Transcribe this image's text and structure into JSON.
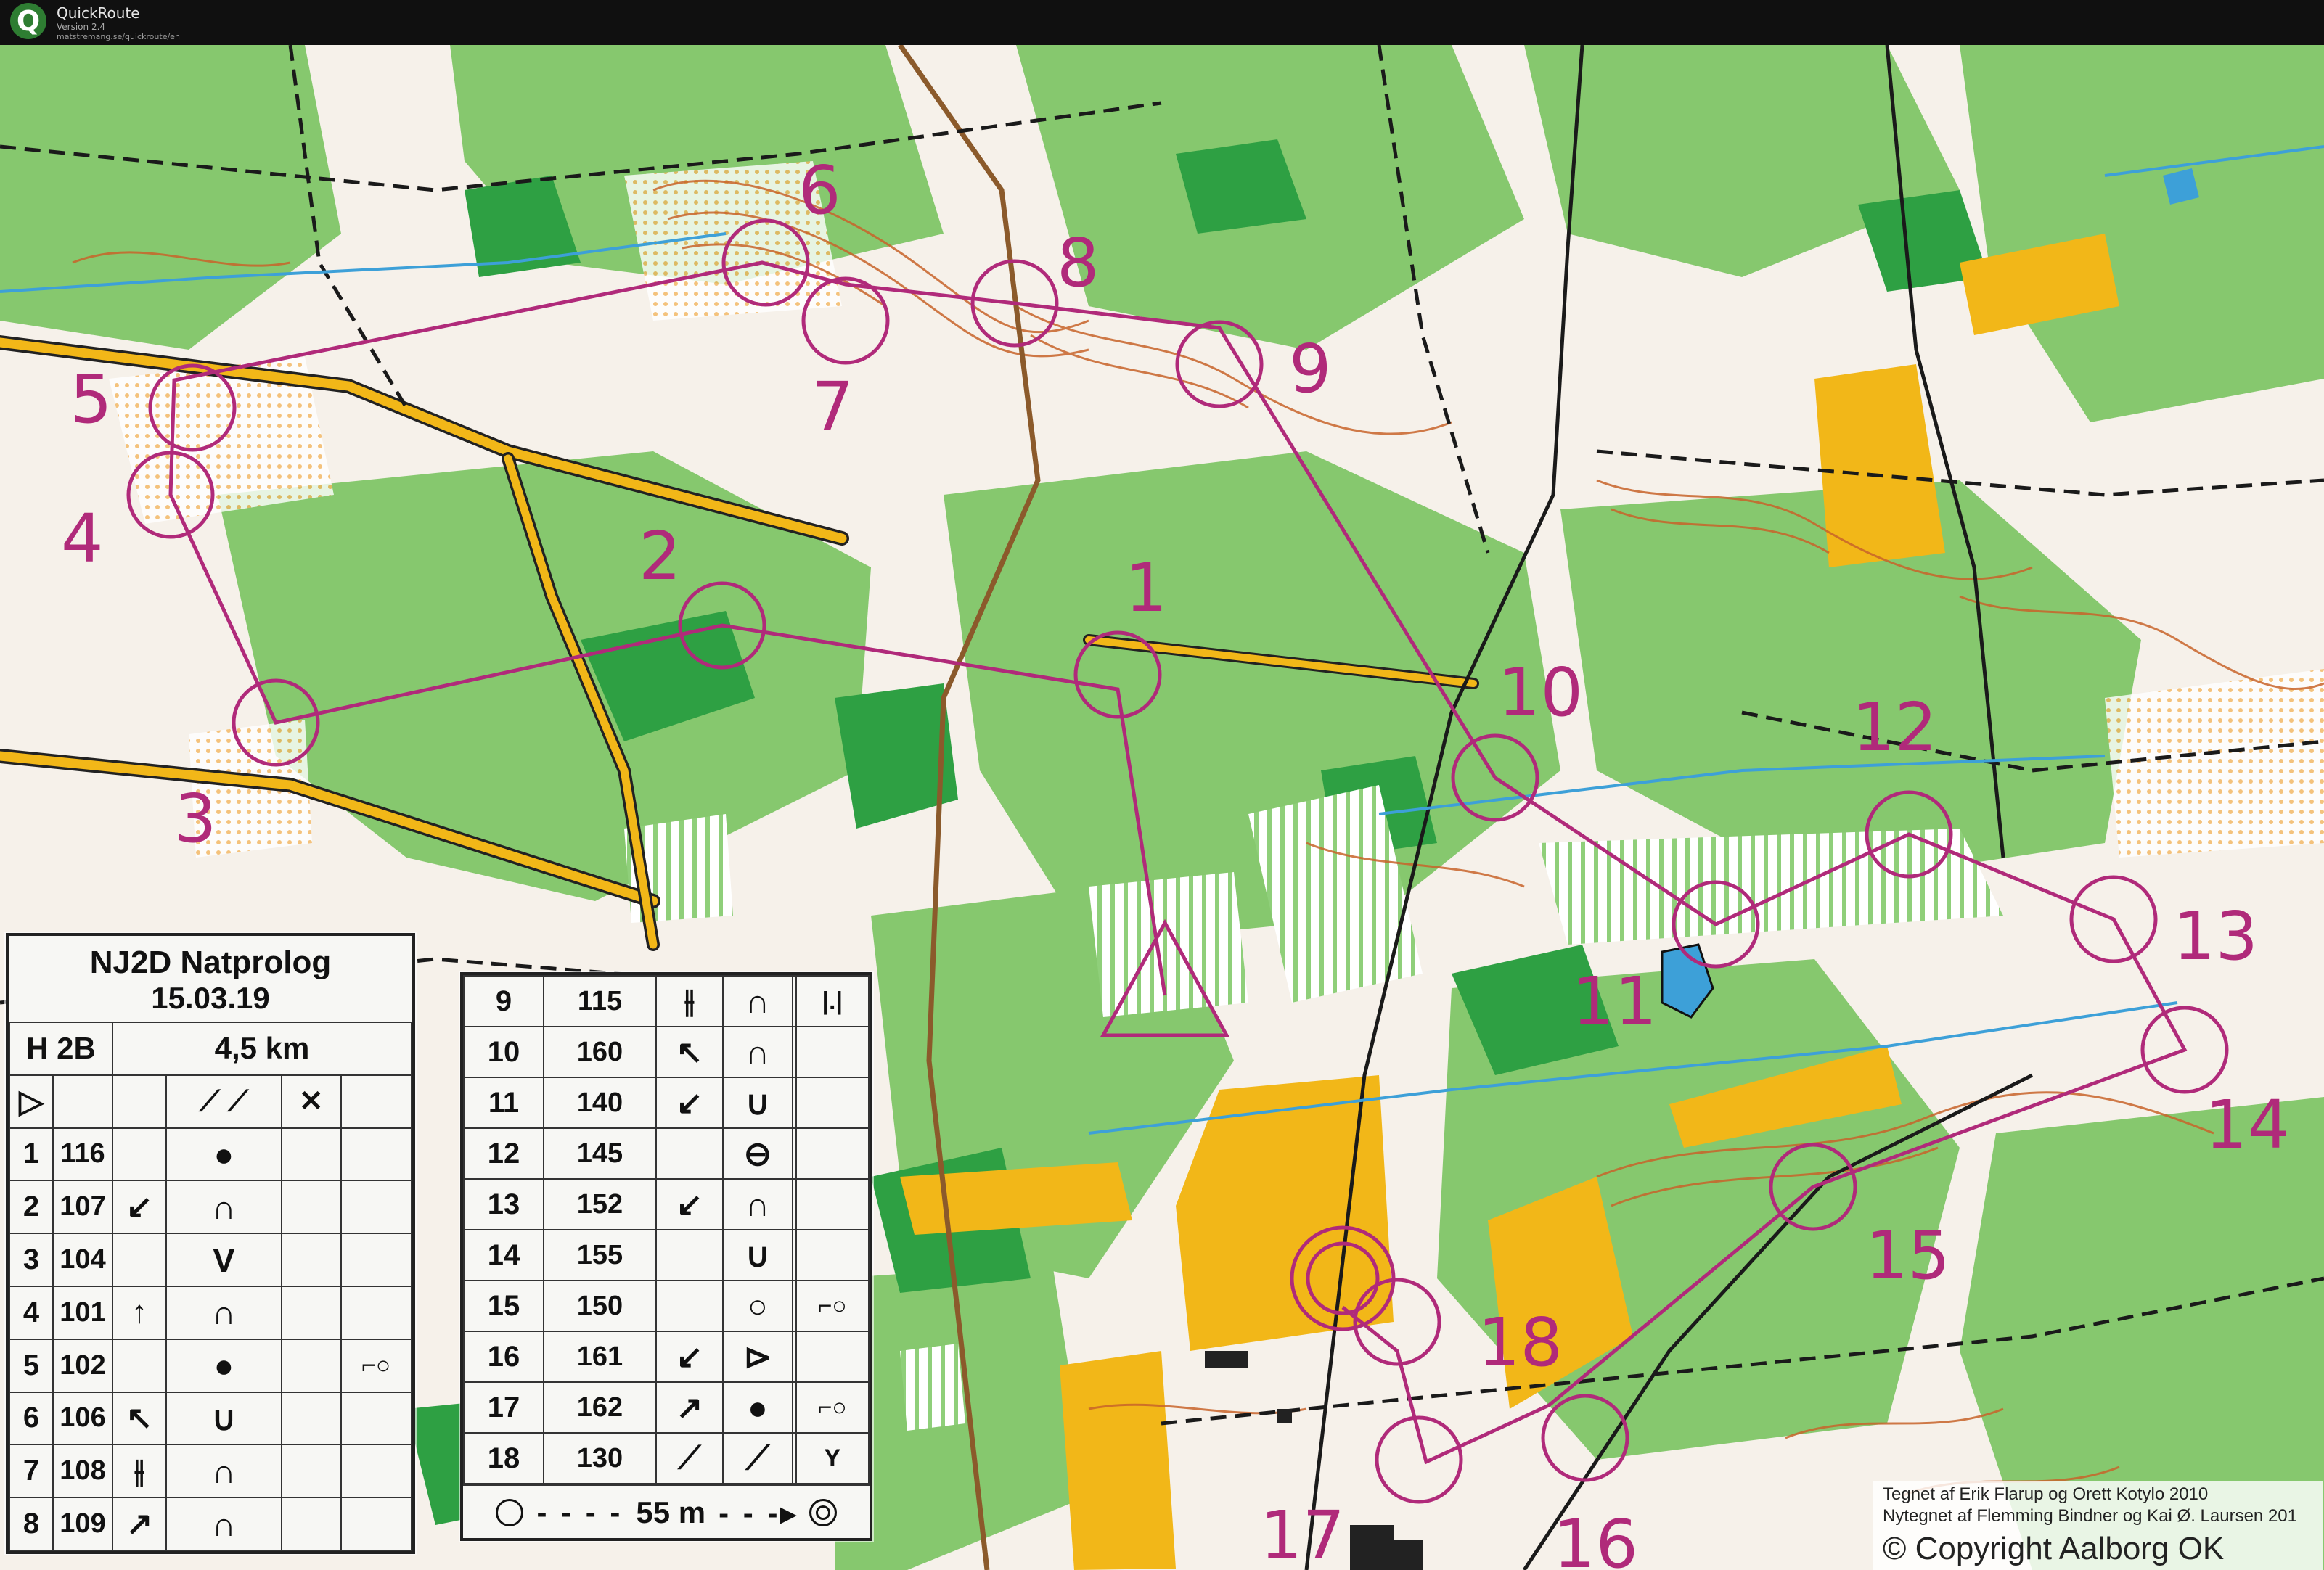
{
  "window": {
    "app_name": "QuickRoute",
    "version": "Version 2.4",
    "url": "matstremang.se/quickroute/en",
    "logo_letter": "Q"
  },
  "colors": {
    "course": "#b02a7a",
    "forest": "#7cc268",
    "dense_forest": "#2ea043",
    "open_yellow": "#f2b718",
    "contour": "#c8642a",
    "road": "#f2b718",
    "water": "#3da0d8"
  },
  "controls": [
    "1",
    "2",
    "3",
    "4",
    "5",
    "6",
    "7",
    "8",
    "9",
    "10",
    "11",
    "12",
    "13",
    "14",
    "15",
    "16",
    "17",
    "18"
  ],
  "description_sheet": {
    "event": "NJ2D Natprolog",
    "date": "15.03.19",
    "class": "H 2B",
    "length": "4,5 km",
    "start_symbol": "▷",
    "rows_left": [
      {
        "n": "1",
        "code": "116",
        "dir": "",
        "feature": "●",
        "extra": ""
      },
      {
        "n": "2",
        "code": "107",
        "dir": "↙",
        "feature": "∩",
        "extra": ""
      },
      {
        "n": "3",
        "code": "104",
        "dir": "",
        "feature": "V",
        "extra": ""
      },
      {
        "n": "4",
        "code": "101",
        "dir": "↑",
        "feature": "∩",
        "extra": ""
      },
      {
        "n": "5",
        "code": "102",
        "dir": "",
        "feature": "●",
        "extra": "⌐○"
      },
      {
        "n": "6",
        "code": "106",
        "dir": "↖",
        "feature": "∪",
        "extra": ""
      },
      {
        "n": "7",
        "code": "108",
        "dir": "⫲",
        "feature": "∩",
        "extra": ""
      },
      {
        "n": "8",
        "code": "109",
        "dir": "↗",
        "feature": "∩",
        "extra": ""
      }
    ],
    "rows_right": [
      {
        "n": "9",
        "code": "115",
        "dir": "⫲",
        "feature": "∩",
        "extra": "|.|"
      },
      {
        "n": "10",
        "code": "160",
        "dir": "↖",
        "feature": "∩",
        "extra": ""
      },
      {
        "n": "11",
        "code": "140",
        "dir": "↙",
        "feature": "∪",
        "extra": ""
      },
      {
        "n": "12",
        "code": "145",
        "dir": "",
        "feature": "⊖",
        "extra": ""
      },
      {
        "n": "13",
        "code": "152",
        "dir": "↙",
        "feature": "∩",
        "extra": ""
      },
      {
        "n": "14",
        "code": "155",
        "dir": "",
        "feature": "∪",
        "extra": ""
      },
      {
        "n": "15",
        "code": "150",
        "dir": "",
        "feature": "○",
        "extra": "⌐○"
      },
      {
        "n": "16",
        "code": "161",
        "dir": "↙",
        "feature": "⊳",
        "extra": ""
      },
      {
        "n": "17",
        "code": "162",
        "dir": "↗",
        "feature": "●",
        "extra": "⌐○"
      },
      {
        "n": "18",
        "code": "130",
        "dir": "⟋",
        "feature": "⟋",
        "extra": "Y"
      }
    ],
    "finish": "55 m"
  },
  "credits": {
    "line1": "Tegnet af Erik Flarup og Orett Kotylo 2010",
    "line2": "Nytegnet af Flemming Bindner og Kai Ø. Laursen 201",
    "copyright": "© Copyright  Aalborg OK"
  }
}
